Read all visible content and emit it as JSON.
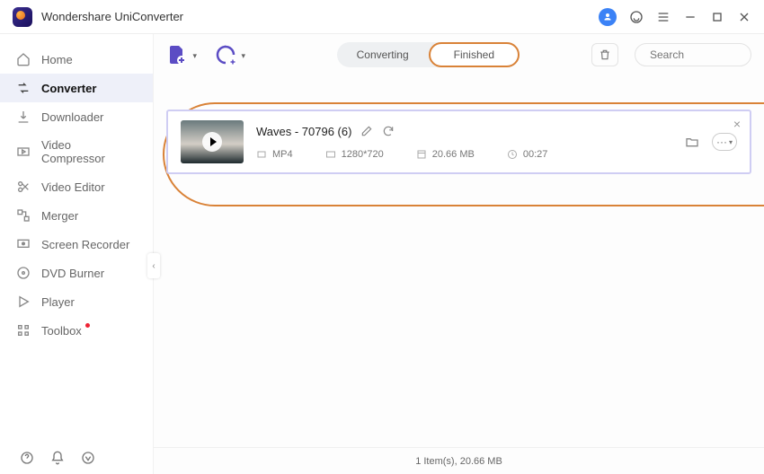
{
  "app": {
    "title": "Wondershare UniConverter"
  },
  "sidebar": {
    "items": [
      {
        "label": "Home"
      },
      {
        "label": "Converter"
      },
      {
        "label": "Downloader"
      },
      {
        "label": "Video Compressor"
      },
      {
        "label": "Video Editor"
      },
      {
        "label": "Merger"
      },
      {
        "label": "Screen Recorder"
      },
      {
        "label": "DVD Burner"
      },
      {
        "label": "Player"
      },
      {
        "label": "Toolbox"
      }
    ]
  },
  "tabs": {
    "converting": "Converting",
    "finished": "Finished"
  },
  "search": {
    "placeholder": "Search"
  },
  "file": {
    "title": "Waves - 70796 (6)",
    "format": "MP4",
    "resolution": "1280*720",
    "size": "20.66 MB",
    "duration": "00:27"
  },
  "status": {
    "summary": "1 Item(s), 20.66 MB"
  }
}
